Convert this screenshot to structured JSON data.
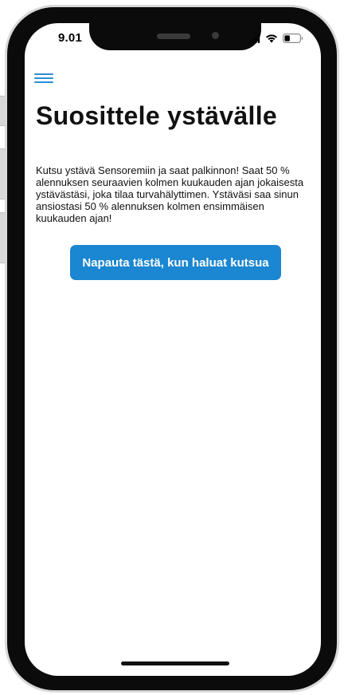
{
  "status_bar": {
    "time": "9.01"
  },
  "header": {
    "menu_icon": "hamburger-menu-icon"
  },
  "main": {
    "title": "Suosittele ystävälle",
    "description": "Kutsu ystävä Sensoremiin ja saat palkinnon! Saat 50 % alennuksen seuraavien kolmen kuukauden ajan jokaisesta ystävästäsi, joka tilaa turvahälyttimen. Ystäväsi saa sinun ansiostasi 50 % alennuksen kolmen ensimmäisen kuukauden ajan!",
    "invite_button_label": "Napauta tästä, kun haluat kutsua"
  },
  "colors": {
    "accent": "#1b86d1",
    "menu_icon": "#2b8fd6",
    "text": "#111111",
    "background": "#ffffff"
  }
}
